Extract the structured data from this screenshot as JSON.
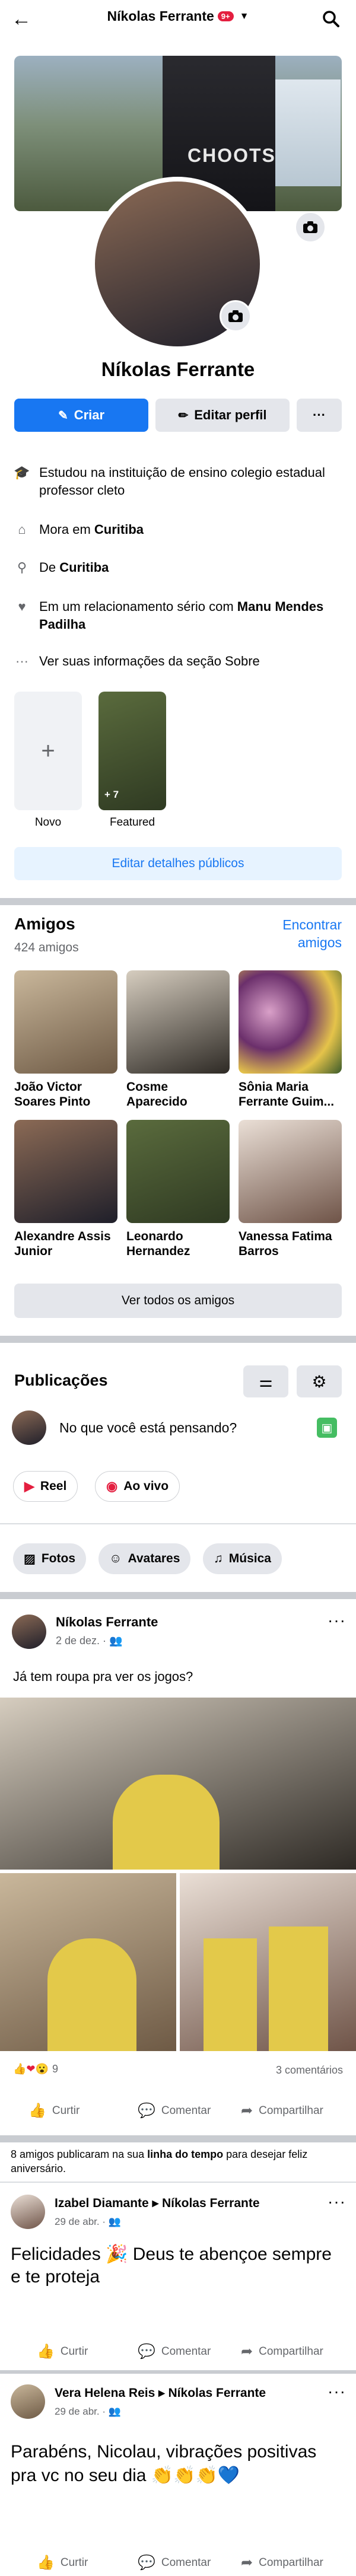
{
  "topbar": {
    "back_icon": "arrow-left-icon",
    "name": "Níkolas Ferrante",
    "badge": "9+",
    "search_icon": "search-icon"
  },
  "profile": {
    "cover_text": "CHOOTS",
    "name": "Níkolas Ferrante",
    "create_label": "Criar",
    "edit_label": "Editar perfil",
    "more_label": "···"
  },
  "about": {
    "education": "Estudou na instituição de ensino colegio estadual professor cleto",
    "lives_prefix": "Mora em ",
    "lives_city": "Curitiba",
    "from_prefix": "De ",
    "from_city": "Curitiba",
    "relationship_prefix": "Em um relacionamento sério com ",
    "relationship_name": "Manu Mendes Padilha",
    "see_about": "Ver suas informações da seção Sobre",
    "edit_public": "Editar detalhes públicos"
  },
  "featured": {
    "new_label": "Novo",
    "featured_label": "Featured",
    "count": "+ 7",
    "plus": "+"
  },
  "friends": {
    "title": "Amigos",
    "count": "424 amigos",
    "find_label": "Encontrar amigos",
    "see_all": "Ver todos os amigos",
    "list": [
      {
        "name": "João Victor Soares Pinto"
      },
      {
        "name": "Cosme Aparecido"
      },
      {
        "name": "Sônia Maria Ferrante Guim..."
      },
      {
        "name": "Alexandre Assis Junior"
      },
      {
        "name": "Leonardo Hernandez"
      },
      {
        "name": "Vanessa Fatima Barros"
      }
    ]
  },
  "posts": {
    "title": "Publicações",
    "composer": "No que você está pensando?",
    "reel": "Reel",
    "live": "Ao vivo",
    "tabs": [
      "Fotos",
      "Avatares",
      "Música"
    ]
  },
  "post1": {
    "author": "Níkolas Ferrante",
    "date": "2 de dez. ·",
    "text": "Já tem roupa pra ver os jogos?",
    "reactions": "9",
    "comments": "3 comentários",
    "like": "Curtir",
    "comment": "Comentar",
    "share": "Compartilhar"
  },
  "birthday": {
    "notice_a": "8 amigos publicaram na sua ",
    "notice_b": "linha do tempo",
    "notice_c": " para desejar feliz aniversário.",
    "p1_author": "Izabel Diamante",
    "p1_target": "Níkolas Ferrante",
    "p1_date": "29 de abr. ·",
    "p1_text": "Felicidades 🎉 Deus te abençoe sempre e te proteja",
    "p2_author": "Vera Helena Reis",
    "p2_target": "Níkolas Ferrante",
    "p2_date": "29 de abr. ·",
    "p2_text": "Parabéns, Nicolau, vibrações positivas pra vc no seu dia 👏👏👏💙",
    "like": "Curtir",
    "comment": "Comentar",
    "share": "Compartilhar"
  },
  "colors": {
    "accent": "#1877f2",
    "light_blue": "#e7f3ff",
    "grey": "#e4e6eb",
    "divider": "#c9ccd1"
  }
}
